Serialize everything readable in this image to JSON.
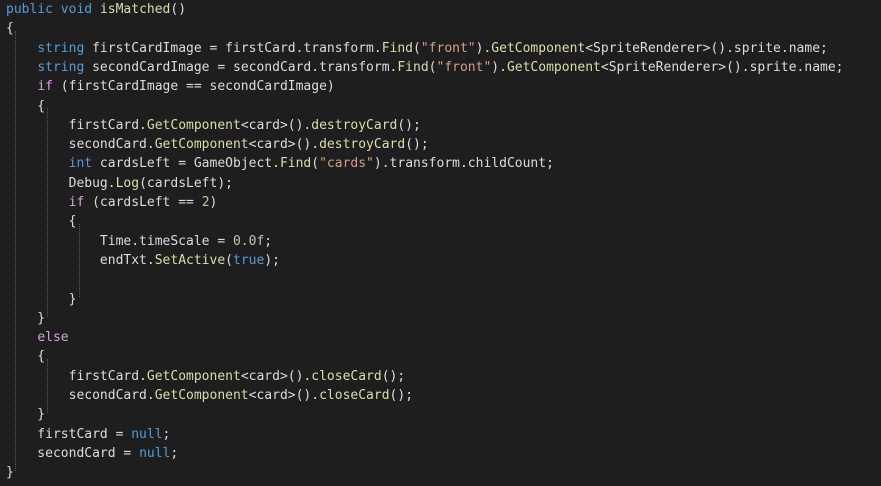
{
  "colors": {
    "background": "#1e1e1e",
    "keyword": "#569cd6",
    "method": "#dcdcaa",
    "string": "#d69d85",
    "number": "#b5cea8",
    "control": "#d8a0df",
    "plain": "#dcdcdc",
    "guide": "#5a5a5a"
  },
  "lines": [
    [
      {
        "t": "public",
        "k": "keyword"
      },
      {
        "t": " ",
        "k": "plain"
      },
      {
        "t": "void",
        "k": "keyword"
      },
      {
        "t": " ",
        "k": "plain"
      },
      {
        "t": "isMatched",
        "k": "method"
      },
      {
        "t": "()",
        "k": "plain"
      }
    ],
    [
      {
        "t": "{",
        "k": "plain"
      }
    ],
    [
      {
        "t": "    ",
        "k": "plain"
      },
      {
        "t": "string",
        "k": "keyword"
      },
      {
        "t": " firstCardImage = firstCard.transform.",
        "k": "plain"
      },
      {
        "t": "Find",
        "k": "method"
      },
      {
        "t": "(",
        "k": "plain"
      },
      {
        "t": "\"front\"",
        "k": "string"
      },
      {
        "t": ").",
        "k": "plain"
      },
      {
        "t": "GetComponent",
        "k": "method"
      },
      {
        "t": "<SpriteRenderer>().sprite.name;",
        "k": "plain"
      }
    ],
    [
      {
        "t": "    ",
        "k": "plain"
      },
      {
        "t": "string",
        "k": "keyword"
      },
      {
        "t": " secondCardImage = secondCard.transform.",
        "k": "plain"
      },
      {
        "t": "Find",
        "k": "method"
      },
      {
        "t": "(",
        "k": "plain"
      },
      {
        "t": "\"front\"",
        "k": "string"
      },
      {
        "t": ").",
        "k": "plain"
      },
      {
        "t": "GetComponent",
        "k": "method"
      },
      {
        "t": "<SpriteRenderer>().sprite.name;",
        "k": "plain"
      }
    ],
    [
      {
        "t": "    ",
        "k": "plain"
      },
      {
        "t": "if",
        "k": "control"
      },
      {
        "t": " (firstCardImage == secondCardImage)",
        "k": "plain"
      }
    ],
    [
      {
        "t": "    {",
        "k": "plain"
      }
    ],
    [
      {
        "t": "        firstCard.",
        "k": "plain"
      },
      {
        "t": "GetComponent",
        "k": "method"
      },
      {
        "t": "<card>().",
        "k": "plain"
      },
      {
        "t": "destroyCard",
        "k": "method"
      },
      {
        "t": "();",
        "k": "plain"
      }
    ],
    [
      {
        "t": "        secondCard.",
        "k": "plain"
      },
      {
        "t": "GetComponent",
        "k": "method"
      },
      {
        "t": "<card>().",
        "k": "plain"
      },
      {
        "t": "destroyCard",
        "k": "method"
      },
      {
        "t": "();",
        "k": "plain"
      }
    ],
    [
      {
        "t": "        ",
        "k": "plain"
      },
      {
        "t": "int",
        "k": "keyword"
      },
      {
        "t": " cardsLeft = GameObject.",
        "k": "plain"
      },
      {
        "t": "Find",
        "k": "method"
      },
      {
        "t": "(",
        "k": "plain"
      },
      {
        "t": "\"cards\"",
        "k": "string"
      },
      {
        "t": ").transform.childCount;",
        "k": "plain"
      }
    ],
    [
      {
        "t": "        Debug.",
        "k": "plain"
      },
      {
        "t": "Log",
        "k": "method"
      },
      {
        "t": "(cardsLeft);",
        "k": "plain"
      }
    ],
    [
      {
        "t": "        ",
        "k": "plain"
      },
      {
        "t": "if",
        "k": "control"
      },
      {
        "t": " (cardsLeft == ",
        "k": "plain"
      },
      {
        "t": "2",
        "k": "number"
      },
      {
        "t": ")",
        "k": "plain"
      }
    ],
    [
      {
        "t": "        {",
        "k": "plain"
      }
    ],
    [
      {
        "t": "            Time.timeScale = ",
        "k": "plain"
      },
      {
        "t": "0.0f",
        "k": "number"
      },
      {
        "t": ";",
        "k": "plain"
      }
    ],
    [
      {
        "t": "            endTxt.",
        "k": "plain"
      },
      {
        "t": "SetActive",
        "k": "method"
      },
      {
        "t": "(",
        "k": "plain"
      },
      {
        "t": "true",
        "k": "keyword"
      },
      {
        "t": ");",
        "k": "plain"
      }
    ],
    [
      {
        "t": "",
        "k": "plain"
      }
    ],
    [
      {
        "t": "        }",
        "k": "plain"
      }
    ],
    [
      {
        "t": "    }",
        "k": "plain"
      }
    ],
    [
      {
        "t": "    ",
        "k": "plain"
      },
      {
        "t": "else",
        "k": "control"
      }
    ],
    [
      {
        "t": "    {",
        "k": "plain"
      }
    ],
    [
      {
        "t": "        firstCard.",
        "k": "plain"
      },
      {
        "t": "GetComponent",
        "k": "method"
      },
      {
        "t": "<card>().",
        "k": "plain"
      },
      {
        "t": "closeCard",
        "k": "method"
      },
      {
        "t": "();",
        "k": "plain"
      }
    ],
    [
      {
        "t": "        secondCard.",
        "k": "plain"
      },
      {
        "t": "GetComponent",
        "k": "method"
      },
      {
        "t": "<card>().",
        "k": "plain"
      },
      {
        "t": "closeCard",
        "k": "method"
      },
      {
        "t": "();",
        "k": "plain"
      }
    ],
    [
      {
        "t": "    }",
        "k": "plain"
      }
    ],
    [
      {
        "t": "    firstCard = ",
        "k": "plain"
      },
      {
        "t": "null",
        "k": "keyword"
      },
      {
        "t": ";",
        "k": "plain"
      }
    ],
    [
      {
        "t": "    secondCard = ",
        "k": "plain"
      },
      {
        "t": "null",
        "k": "keyword"
      },
      {
        "t": ";",
        "k": "plain"
      }
    ],
    [
      {
        "t": "}",
        "k": "plain"
      }
    ]
  ]
}
